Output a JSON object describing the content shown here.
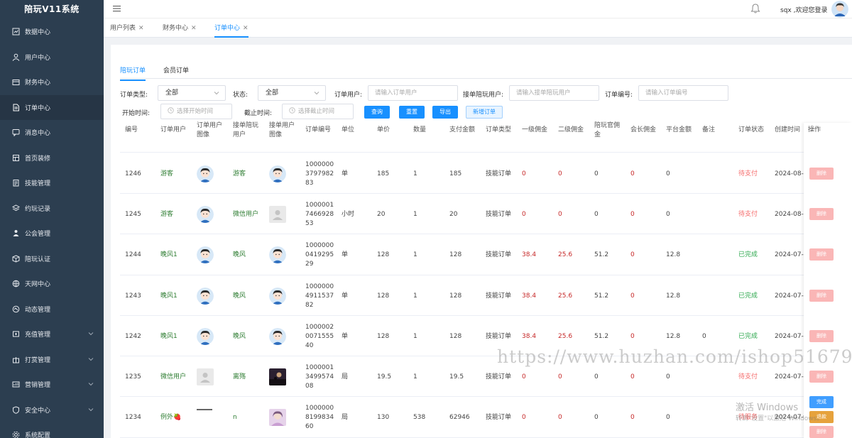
{
  "app": {
    "title": "陪玩V11系统"
  },
  "sidebar": {
    "items": [
      {
        "label": "数据中心",
        "icon": "chart-icon"
      },
      {
        "label": "用户中心",
        "icon": "user-icon"
      },
      {
        "label": "财务中心",
        "icon": "wallet-icon"
      },
      {
        "label": "订单中心",
        "icon": "document-icon"
      },
      {
        "label": "消息中心",
        "icon": "message-icon"
      },
      {
        "label": "首页装修",
        "icon": "home-icon"
      },
      {
        "label": "技能管理",
        "icon": "clipboard-icon"
      },
      {
        "label": "约玩记录",
        "icon": "layers-icon"
      },
      {
        "label": "公会管理",
        "icon": "group-icon"
      },
      {
        "label": "陪玩认证",
        "icon": "cube-icon"
      },
      {
        "label": "天网中心",
        "icon": "globe-icon"
      },
      {
        "label": "动态管理",
        "icon": "dynamic-icon"
      },
      {
        "label": "充值管理",
        "icon": "recharge-icon"
      },
      {
        "label": "打赏管理",
        "icon": "gift-icon"
      },
      {
        "label": "营销管理",
        "icon": "marketing-icon"
      },
      {
        "label": "安全中心",
        "icon": "shield-icon"
      },
      {
        "label": "系统配置",
        "icon": "settings-icon"
      }
    ],
    "active": "订单中心"
  },
  "header": {
    "welcome": "sqx ,欢迎您登录"
  },
  "page_tabs": [
    {
      "label": "用户列表"
    },
    {
      "label": "财务中心"
    },
    {
      "label": "订单中心"
    }
  ],
  "order_tabs": [
    {
      "label": "陪玩订单"
    },
    {
      "label": "会员订单"
    }
  ],
  "filters": {
    "type_label": "订单类型:",
    "type_value": "全部",
    "status_label": "状态:",
    "status_value": "全部",
    "user_label": "订单用户:",
    "user_placeholder": "请输入订单用户",
    "companion_label": "接单陪玩用户:",
    "companion_placeholder": "请输入接单陪玩用户",
    "no_label": "订单编号:",
    "no_placeholder": "请输入订单编号",
    "start_label": "开始时间:",
    "start_placeholder": "选择开始时间",
    "end_label": "截止时间:",
    "end_placeholder": "选择截止时间",
    "query_btn": "查询",
    "reset_btn": "重置",
    "export_btn": "导出",
    "add_btn": "新增订单"
  },
  "table": {
    "headers": {
      "id": "编号",
      "user": "订单用户",
      "user_img": "订单用户图像",
      "comp": "接单陪玩用户",
      "comp_img": "接单用户图像",
      "order_no": "订单编号",
      "unit": "单位",
      "price": "单价",
      "qty": "数量",
      "paid": "支付金额",
      "type": "订单类型",
      "c1": "一级佣金",
      "c2": "二级佣金",
      "official": "陪玩官佣金",
      "chief": "会长佣金",
      "platform": "平台金额",
      "remark": "备注",
      "status": "订单状态",
      "created": "创建时间",
      "ops": "操作"
    },
    "rows": [
      {
        "id": "1246",
        "user": "游客",
        "comp": "游客",
        "order_no": "100000037979828 3",
        "order_no_lines": [
          "1000000",
          "3797982",
          "83"
        ],
        "unit": "单",
        "price": "185",
        "qty": "1",
        "paid": "185",
        "type": "技能订单",
        "c1": "0",
        "c2": "0",
        "official": "0",
        "chief": "0",
        "platform": "0",
        "remark": "",
        "status": "待支付",
        "created": "2024-08-26",
        "ops": [
          "删除"
        ]
      },
      {
        "id": "1245",
        "user": "游客",
        "comp": "微信用户",
        "order_no_lines": [
          "1000001",
          "7466928",
          "53"
        ],
        "unit": "小时",
        "price": "20",
        "qty": "1",
        "paid": "20",
        "type": "技能订单",
        "c1": "0",
        "c2": "0",
        "official": "0",
        "chief": "0",
        "platform": "0",
        "remark": "",
        "status": "待支付",
        "created": "2024-08-01",
        "ops": [
          "删除"
        ]
      },
      {
        "id": "1244",
        "user": "晚风1",
        "comp": "晚风",
        "order_no_lines": [
          "1000000",
          "0419295",
          "29"
        ],
        "unit": "单",
        "price": "128",
        "qty": "1",
        "paid": "128",
        "type": "技能订单",
        "c1": "38.4",
        "c2": "25.6",
        "official": "51.2",
        "chief": "0",
        "platform": "12.8",
        "remark": "",
        "status": "已完成",
        "created": "2024-07-23",
        "ops": [
          "删除"
        ]
      },
      {
        "id": "1243",
        "user": "晚风1",
        "comp": "晚风",
        "order_no_lines": [
          "1000000",
          "4911537",
          "82"
        ],
        "unit": "单",
        "price": "128",
        "qty": "1",
        "paid": "128",
        "type": "技能订单",
        "c1": "38.4",
        "c2": "25.6",
        "official": "51.2",
        "chief": "0",
        "platform": "12.8",
        "remark": "",
        "status": "已完成",
        "created": "2024-07-23",
        "ops": [
          "删除"
        ]
      },
      {
        "id": "1242",
        "user": "晚风1",
        "comp": "晚风",
        "order_no_lines": [
          "1000002",
          "0071555",
          "40"
        ],
        "unit": "单",
        "price": "128",
        "qty": "1",
        "paid": "128",
        "type": "技能订单",
        "c1": "38.4",
        "c2": "25.6",
        "official": "51.2",
        "chief": "0",
        "platform": "12.8",
        "remark": "0",
        "status": "已完成",
        "created": "2024-07-23",
        "ops": [
          "删除"
        ]
      },
      {
        "id": "1235",
        "user": "微信用户",
        "comp": "离殇",
        "order_no_lines": [
          "1000001",
          "3499574",
          "08"
        ],
        "unit": "局",
        "price": "19.5",
        "qty": "1",
        "paid": "19.5",
        "type": "技能订单",
        "c1": "0",
        "c2": "0",
        "official": "0",
        "chief": "0",
        "platform": "0",
        "remark": "",
        "status": "待支付",
        "created": "2024-07-12",
        "ops": [
          "删除"
        ]
      },
      {
        "id": "1234",
        "user": "例外🍓",
        "comp": "n",
        "order_no_lines": [
          "1000000",
          "8199834",
          "60"
        ],
        "unit": "局",
        "price": "130",
        "qty": "538",
        "paid": "62946",
        "type": "技能订单",
        "c1": "0",
        "c2": "0",
        "official": "0",
        "chief": "0",
        "platform": "0",
        "remark": "",
        "status": "待服务",
        "created": "2024-07-11",
        "ops": [
          "完成",
          "退款",
          "删除"
        ]
      }
    ]
  },
  "overlay": {
    "watermark": "https://www.huzhan.com/ishop51679",
    "activate_title": "激活 Windows",
    "activate_sub": "转到\"设置\"以激活 Windows。"
  },
  "colors": {
    "sidebar_bg": "#2c3e50",
    "accent": "#1890ff",
    "danger": "#f56c6c",
    "success": "#2fa84f"
  }
}
